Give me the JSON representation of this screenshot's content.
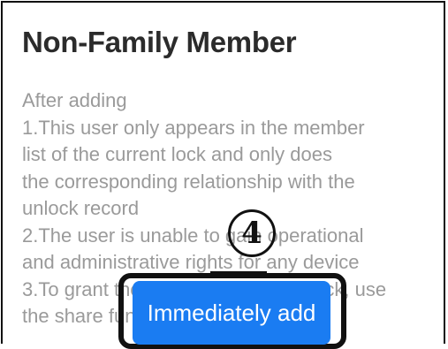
{
  "dialog": {
    "title": "Non-Family Member",
    "description_lines": [
      "After adding",
      "1.This user only appears in the member",
      "list of the current lock and only does",
      "the corresponding relationship with the",
      "unlock record",
      "2.The user is unable to gain operational",
      "and administrative rights for any device",
      "3.To grant the user access to the lock, use",
      "the share function"
    ],
    "button_label": "Immediately add",
    "step_badge": "4"
  },
  "colors": {
    "title": "#2b2b2b",
    "description": "#9a9a9a",
    "button_background": "#1a7cf2",
    "button_text": "#ffffff",
    "annotation": "#111111"
  }
}
